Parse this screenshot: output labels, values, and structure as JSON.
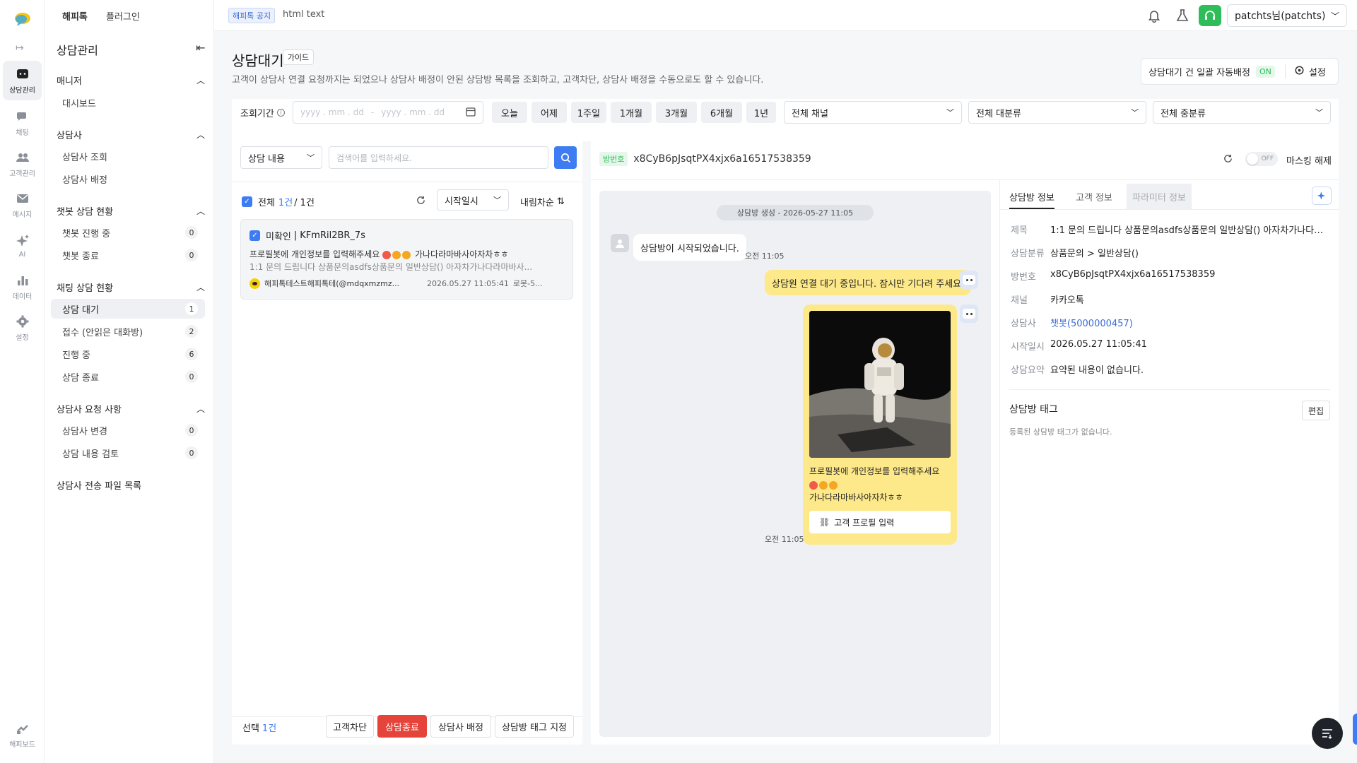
{
  "rail": {
    "items": [
      {
        "label": "상담관리",
        "icon": "chat-manage-icon"
      },
      {
        "label": "채팅",
        "icon": "chat-bubbles-icon"
      },
      {
        "label": "고객관리",
        "icon": "customers-icon"
      },
      {
        "label": "메시지",
        "icon": "mail-icon"
      },
      {
        "label": "AI",
        "icon": "sparkle-icon"
      },
      {
        "label": "데이터",
        "icon": "bar-chart-icon"
      },
      {
        "label": "설정",
        "icon": "gear-icon"
      }
    ],
    "bottom": {
      "label": "해피보드",
      "icon": "happyboard-icon"
    }
  },
  "sidebar": {
    "tabs": [
      "해피톡",
      "플러그인"
    ],
    "title": "상담관리",
    "sections": [
      {
        "title": "매니저",
        "items": [
          {
            "label": "대시보드"
          }
        ]
      },
      {
        "title": "상담사",
        "items": [
          {
            "label": "상담사 조회"
          },
          {
            "label": "상담사 배정"
          }
        ]
      },
      {
        "title": "챗봇 상담 현황",
        "items": [
          {
            "label": "챗봇 진행 중",
            "count": "0"
          },
          {
            "label": "챗봇 종료",
            "count": "0"
          }
        ]
      },
      {
        "title": "채팅 상담 현황",
        "items": [
          {
            "label": "상담 대기",
            "count": "1"
          },
          {
            "label": "접수 (안읽은 대화방)",
            "count": "2"
          },
          {
            "label": "진행 중",
            "count": "6"
          },
          {
            "label": "상담 종료",
            "count": "0"
          }
        ]
      },
      {
        "title": "상담사 요청 사항",
        "items": [
          {
            "label": "상담사 변경",
            "count": "0"
          },
          {
            "label": "상담 내용 검토",
            "count": "0"
          }
        ]
      }
    ],
    "file_list": "상담사 전송 파일 목록"
  },
  "topbar": {
    "notice_badge": "해피톡 공지",
    "notice_text": "html text",
    "user": "patchts님(patchts)"
  },
  "page": {
    "title": "상담대기",
    "guide": "가이드",
    "description": "고객이 상담사 연결 요청까지는 되었으나 상담사 배정이 안된 상담방 목록을 조회하고, 고객차단, 상담사 배정을 수동으로도 할 수 있습니다.",
    "auto_assign_label": "상담대기 건 일괄 자동배정",
    "auto_assign_state": "ON",
    "settings": "설정"
  },
  "filters": {
    "period_label": "조회기간",
    "date_placeholder_from": "yyyy . mm . dd",
    "date_separator": "-",
    "date_placeholder_to": "yyyy . mm . dd",
    "quick": [
      "오늘",
      "어제",
      "1주일",
      "1개월",
      "3개월",
      "6개월",
      "1년"
    ],
    "channel": "전체 채널",
    "major": "전체 대분류",
    "middle": "전체 중분류"
  },
  "list": {
    "search_type": "상담 내용",
    "search_placeholder": "검색어를 입력하세요.",
    "all_label": "전체",
    "count_highlight": "1건",
    "count_total": "/ 1건",
    "sort_field": "시작일시",
    "sort_order": "내림차순",
    "items": [
      {
        "status": "미확인",
        "name": "KFmRil2BR_7s",
        "line1": "프로필봇에 개인정보를 입력해주세요",
        "line1_tail": "가나다라마바사아자차ㅎㅎ",
        "line2": "1:1 문의 드립니다 상품문의asdfs상품문의 일반상담() 아자차가나다라마바사...",
        "account": "해피톡테스트해피톡테(@mdqxmzmz...",
        "time": "2026.05.27 11:05:41",
        "bot": "로봇-5..."
      }
    ],
    "selected_label": "선택",
    "selected_count": "1건",
    "actions": [
      "고객차단",
      "상담종료",
      "상담사 배정",
      "상담방 태그 지정"
    ]
  },
  "chat": {
    "room_badge": "방번호",
    "room_id": "x8CyB6pJsqtPX4xjx6a16517538359",
    "masking_toggle": "OFF",
    "masking_label": "마스킹 해제",
    "system_date": "상담방 생성 - 2026-05-27 11:05",
    "msg_start": "상담방이 시작되었습니다.",
    "msg_start_time": "오전 11:05",
    "msg_wait": "상담원 연결 대기 중입니다. 잠시만 기다려 주세요.",
    "card_text1": "프로필봇에 개인정보를 입력해주세요",
    "card_text2": "가나다라마바사아자차ㅎㅎ",
    "card_button": "고객 프로필 입력",
    "card_time": "오전 11:05"
  },
  "info": {
    "tabs": [
      "상담방 정보",
      "고객 정보",
      "파라미터 정보"
    ],
    "rows": [
      {
        "k": "제목",
        "v": "1:1 문의 드립니다 상품문의asdfs상품문의 일반상담() 아자차가나다라..."
      },
      {
        "k": "상담분류",
        "v": "상품문의 > 일반상담()"
      },
      {
        "k": "방번호",
        "v": "x8CyB6pJsqtPX4xjx6a16517538359"
      },
      {
        "k": "채널",
        "v": "카카오톡"
      },
      {
        "k": "상담사",
        "v": "챗봇(5000000457)"
      },
      {
        "k": "시작일시",
        "v": "2026.05.27 11:05:41"
      },
      {
        "k": "상담요약",
        "v": "요약된 내용이 없습니다."
      }
    ],
    "tag_title": "상담방 태그",
    "tag_edit": "편집",
    "tag_empty": "등록된 상담방 태그가 없습니다."
  },
  "colors": {
    "accent": "#3d7cf2",
    "danger": "#e5443b",
    "bubble": "#fde98a",
    "online": "#2ebd59"
  }
}
